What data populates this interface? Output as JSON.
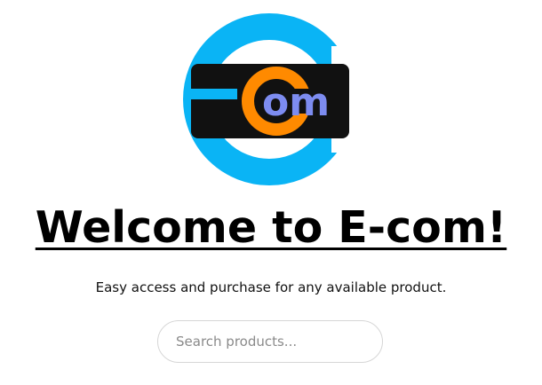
{
  "logo": {
    "text_prefix": "E",
    "text_c": "c",
    "text_om": "om",
    "colors": {
      "ring": "#0ab4f5",
      "band": "#111111",
      "c_letter": "#ff8a00",
      "om_letters": "#7d8cf0"
    }
  },
  "hero": {
    "title": "Welcome to E-com!",
    "subtitle": "Easy access and purchase for any available product."
  },
  "search": {
    "placeholder": "Search products...",
    "value": ""
  }
}
